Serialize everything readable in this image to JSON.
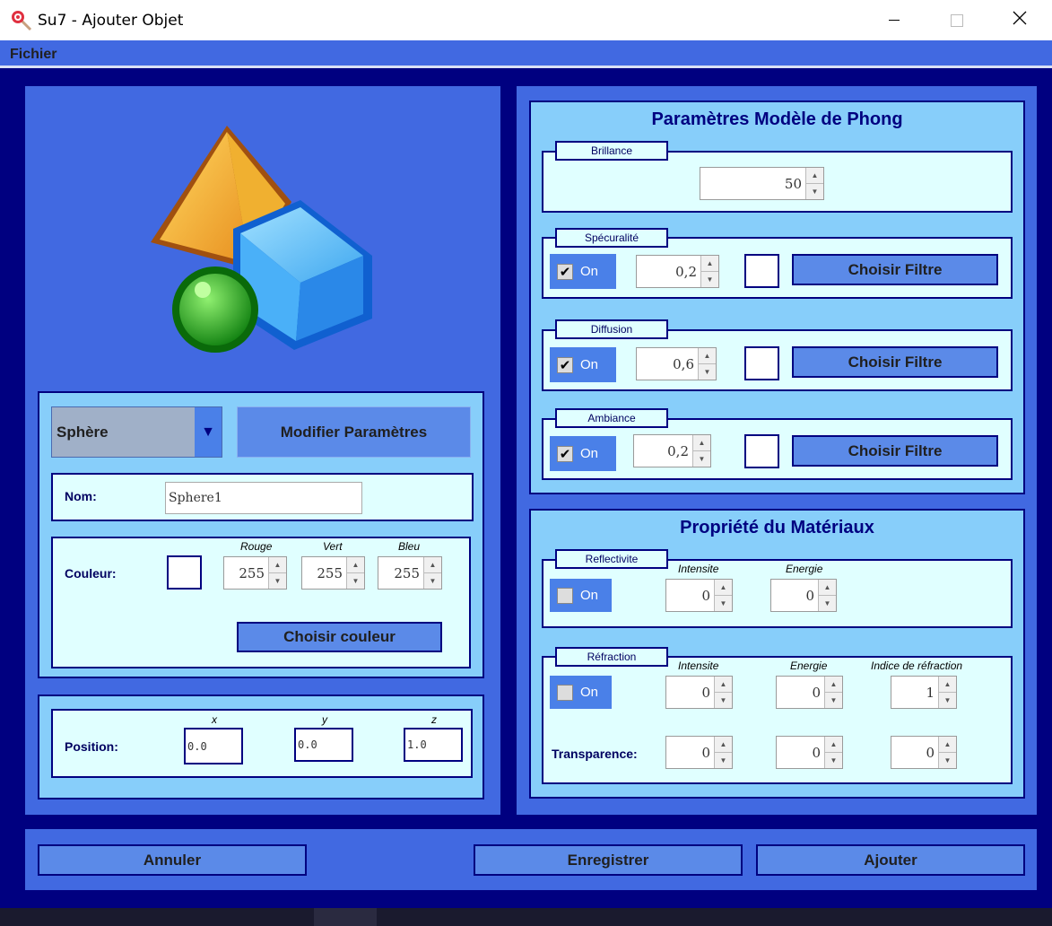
{
  "window": {
    "title": "Su7 - Ajouter Objet",
    "minimize": "—",
    "maximize": "☐",
    "close": "✕"
  },
  "menu": {
    "fichier": "Fichier"
  },
  "left": {
    "shape_select": {
      "value": "Sphère",
      "arrow": "▼"
    },
    "modify_params": "Modifier Paramètres",
    "nom": {
      "label": "Nom:",
      "value": "Sphere1"
    },
    "couleur": {
      "label": "Couleur:",
      "rouge_label": "Rouge",
      "vert_label": "Vert",
      "bleu_label": "Bleu",
      "rouge": "255",
      "vert": "255",
      "bleu": "255",
      "choose_color": "Choisir couleur",
      "swatch_color": "#ffffff"
    },
    "position": {
      "label": "Position:",
      "x_label": "x",
      "y_label": "y",
      "z_label": "z",
      "x": "0.0",
      "y": "0.0",
      "z": "1.0"
    }
  },
  "phong": {
    "title": "Paramètres Modèle de Phong",
    "brillance": {
      "legend": "Brillance",
      "value": "50"
    },
    "specularite": {
      "legend": "Spécuralité",
      "on_label": "On",
      "checked": "✔",
      "value": "0,2",
      "filter": "Choisir Filtre"
    },
    "diffusion": {
      "legend": "Diffusion",
      "on_label": "On",
      "checked": "✔",
      "value": "0,6",
      "filter": "Choisir Filtre"
    },
    "ambiance": {
      "legend": "Ambiance",
      "on_label": "On",
      "checked": "✔",
      "value": "0,2",
      "filter": "Choisir Filtre"
    }
  },
  "materiaux": {
    "title": "Propriété du Matériaux",
    "reflectivite": {
      "legend": "Reflectivite",
      "on_label": "On",
      "intensite_label": "Intensite",
      "energie_label": "Energie",
      "intensite": "0",
      "energie": "0"
    },
    "refraction": {
      "legend": "Réfraction",
      "on_label": "On",
      "intensite_label": "Intensite",
      "energie_label": "Energie",
      "indice_label": "Indice de réfraction",
      "intensite": "0",
      "energie": "0",
      "indice": "1",
      "transparence_label": "Transparence:",
      "t1": "0",
      "t2": "0",
      "t3": "0"
    }
  },
  "footer": {
    "annuler": "Annuler",
    "enregistrer": "Enregistrer",
    "ajouter": "Ajouter"
  },
  "icons": {
    "app": "lollipop-icon",
    "spinner_up": "▲",
    "spinner_down": "▼"
  }
}
